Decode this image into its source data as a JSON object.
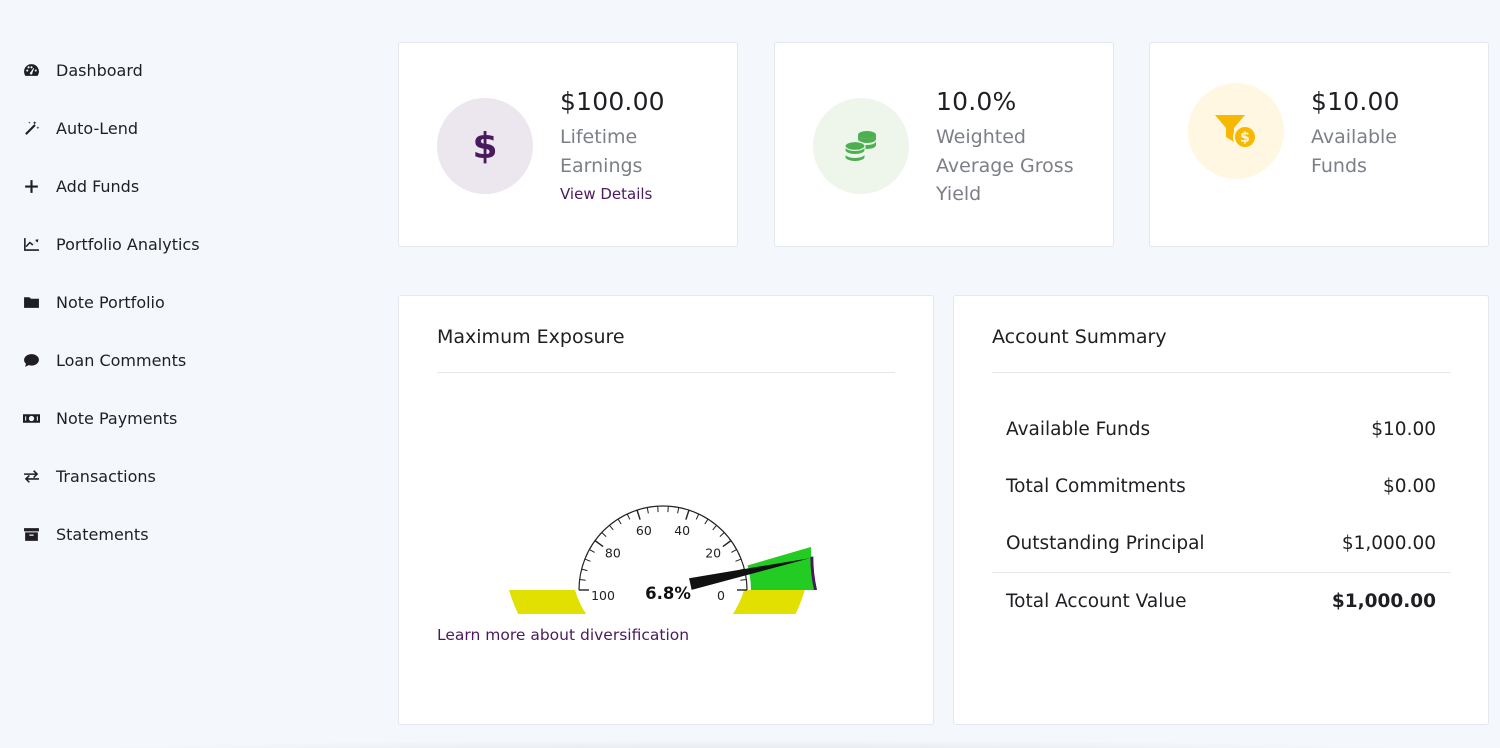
{
  "sidebar": {
    "items": [
      {
        "label": "Dashboard",
        "icon": "dashboard-gauge-icon"
      },
      {
        "label": "Auto-Lend",
        "icon": "magic-wand-icon"
      },
      {
        "label": "Add Funds",
        "icon": "plus-icon"
      },
      {
        "label": "Portfolio Analytics",
        "icon": "line-chart-icon"
      },
      {
        "label": "Note Portfolio",
        "icon": "folder-icon"
      },
      {
        "label": "Loan Comments",
        "icon": "comment-icon"
      },
      {
        "label": "Note Payments",
        "icon": "money-bill-icon"
      },
      {
        "label": "Transactions",
        "icon": "exchange-arrows-icon"
      },
      {
        "label": "Statements",
        "icon": "archive-box-icon"
      }
    ]
  },
  "stats": [
    {
      "value": "$100.00",
      "label_lines": [
        "Lifetime",
        "Earnings"
      ],
      "link": "View Details",
      "icon": "dollar-icon",
      "circle_color": "#ece6ee",
      "icon_color": "#4a1b5c"
    },
    {
      "value": "10.0%",
      "label_lines": [
        "Weighted",
        "Average Gross",
        "Yield"
      ],
      "icon": "coins-stack-icon",
      "circle_color": "#eef6ec",
      "icon_color": "#4caf50"
    },
    {
      "value": "$10.00",
      "label_lines": [
        "Available",
        "Funds"
      ],
      "icon": "funnel-dollar-icon",
      "circle_color": "#fff7e2",
      "icon_color": "#f6b800"
    }
  ],
  "exposure": {
    "title": "Maximum Exposure",
    "gauge_value": 6.8,
    "gauge_readout": "6.8%",
    "gauge_ticks": [
      "100",
      "80",
      "60",
      "40",
      "20",
      "0"
    ],
    "gauge_range": [
      100,
      0
    ],
    "band_colors": {
      "main": "#e2e000",
      "green": "#22cc22",
      "purple": "#4a1b5c"
    },
    "learn_link": "Learn more about diversification"
  },
  "summary": {
    "title": "Account Summary",
    "rows": [
      {
        "label": "Available Funds",
        "value": "$10.00"
      },
      {
        "label": "Total Commitments",
        "value": "$0.00"
      },
      {
        "label": "Outstanding Principal",
        "value": "$1,000.00"
      }
    ],
    "total": {
      "label": "Total Account Value",
      "value": "$1,000.00"
    }
  }
}
